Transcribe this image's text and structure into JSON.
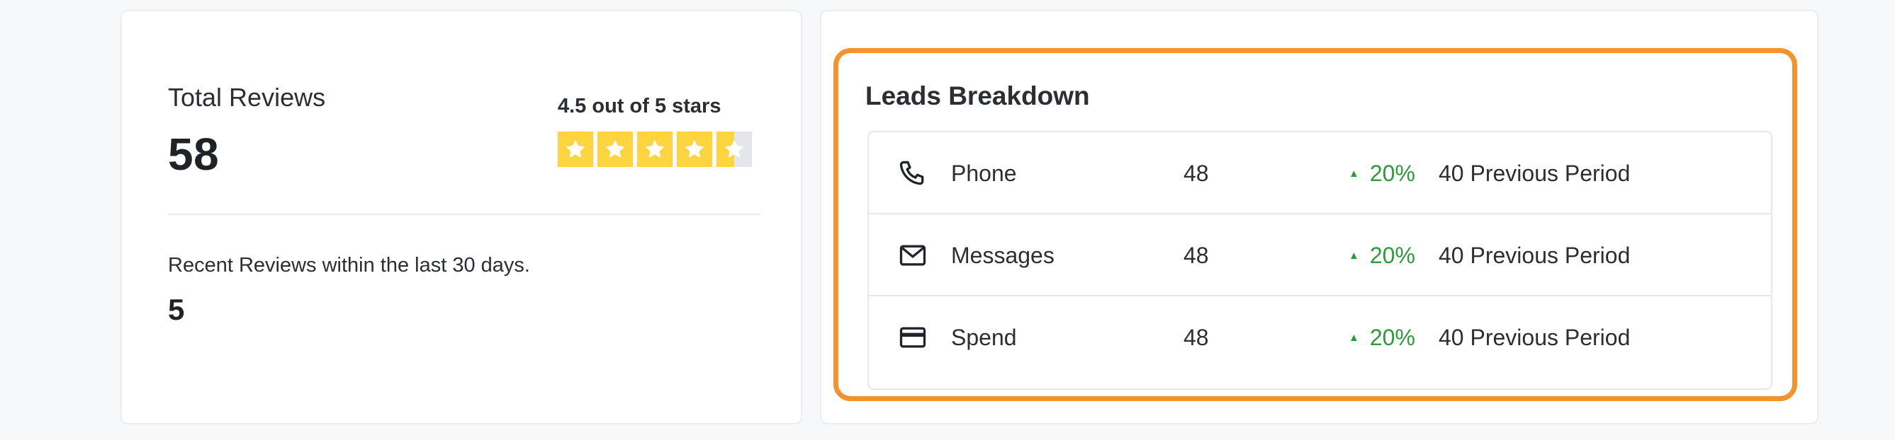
{
  "reviews": {
    "total_label": "Total Reviews",
    "total_value": "58",
    "rating_text": "4.5 out of 5 stars",
    "rating_value": 4.5,
    "rating_max": 5,
    "recent_label": "Recent Reviews within the last 30 days.",
    "recent_value": "5"
  },
  "leads": {
    "title": "Leads Breakdown",
    "rows": [
      {
        "icon": "phone-icon",
        "label": "Phone",
        "count": "48",
        "change": "20%",
        "previous": "40 Previous Period"
      },
      {
        "icon": "mail-icon",
        "label": "Messages",
        "count": "48",
        "change": "20%",
        "previous": "40 Previous Period"
      },
      {
        "icon": "credit-card-icon",
        "label": "Spend",
        "count": "48",
        "change": "20%",
        "previous": "40 Previous Period"
      }
    ]
  },
  "colors": {
    "star": "#fed53f",
    "positive": "#2e9a3a",
    "highlight": "#f4922d"
  }
}
